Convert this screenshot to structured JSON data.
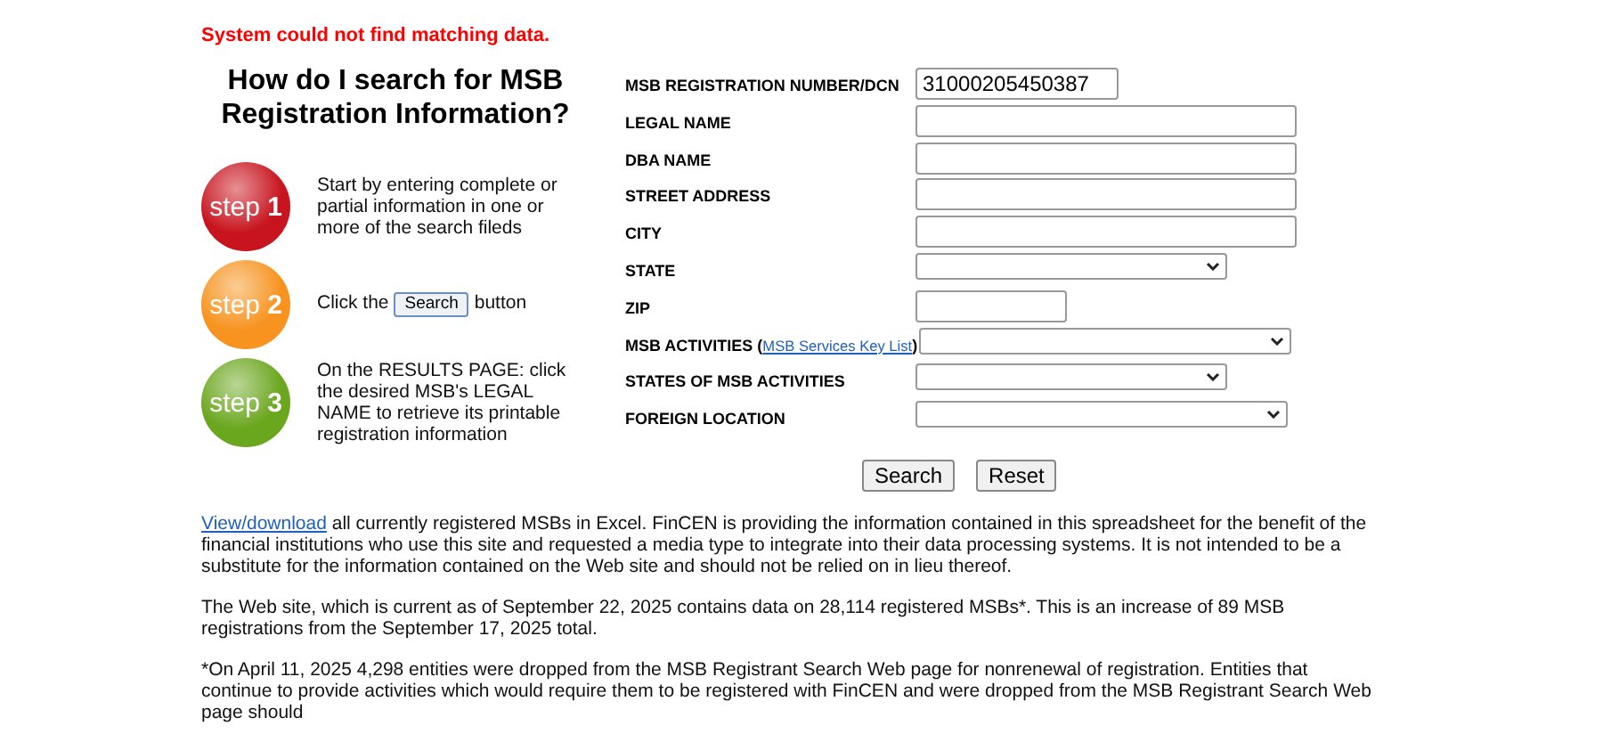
{
  "error": "System could not find matching data.",
  "help": {
    "title": "How do I search for MSB Registration Information?",
    "steps": [
      {
        "word": "step",
        "number": "1",
        "color": "#c8141e",
        "parts": [
          {
            "kind": "text",
            "text": "Start by entering complete or partial information in one or more of the search fileds"
          }
        ]
      },
      {
        "word": "step",
        "number": "2",
        "color": "#f7931e",
        "parts": [
          {
            "kind": "text",
            "text": "Click the"
          },
          {
            "kind": "button",
            "text": "Search"
          },
          {
            "kind": "text",
            "text": "button"
          }
        ]
      },
      {
        "word": "step",
        "number": "3",
        "color": "#6aa61e",
        "parts": [
          {
            "kind": "text",
            "text": "On the RESULTS PAGE: click the desired MSB's LEGAL NAME to retrieve its printable registration information"
          }
        ]
      }
    ]
  },
  "form": {
    "fields": [
      {
        "label": "MSB REGISTRATION NUMBER/DCN",
        "kind": "text",
        "value": "31000205450387"
      },
      {
        "label": "LEGAL NAME",
        "kind": "text"
      },
      {
        "label": "DBA NAME",
        "kind": "text"
      },
      {
        "label": "STREET ADDRESS",
        "kind": "text"
      },
      {
        "label": "CITY",
        "kind": "text"
      },
      {
        "label": "STATE",
        "kind": "select"
      },
      {
        "label": "ZIP",
        "kind": "text"
      },
      {
        "label": "MSB ACTIVITIES (",
        "link": "MSB Services Key List",
        "label_end": ")",
        "kind": "select"
      },
      {
        "label": "STATES OF MSB ACTIVITIES",
        "kind": "select"
      },
      {
        "label": "FOREIGN LOCATION",
        "kind": "select"
      }
    ],
    "buttons": [
      "Search",
      "Reset"
    ]
  },
  "notes": [
    {
      "link": "View/download",
      "text": " all currently registered MSBs in Excel. FinCEN is providing the information contained in this spreadsheet for the benefit of the financial institutions who use this site and requested a media type to integrate into their data processing systems. It is not intended to be a substitute for the information contained on the Web site and should not be relied on in lieu thereof."
    },
    {
      "text": "The Web site, which is current as of September 22, 2025 contains data on 28,114 registered MSBs*. This is an increase of 89 MSB registrations from the September 17, 2025 total."
    },
    {
      "text": "*On April 11, 2025 4,298 entities were dropped from the MSB Registrant Search Web page for nonrenewal of registration. Entities that continue to provide activities which would require them to be registered with FinCEN and were dropped from the MSB Registrant Search Web page should"
    }
  ]
}
